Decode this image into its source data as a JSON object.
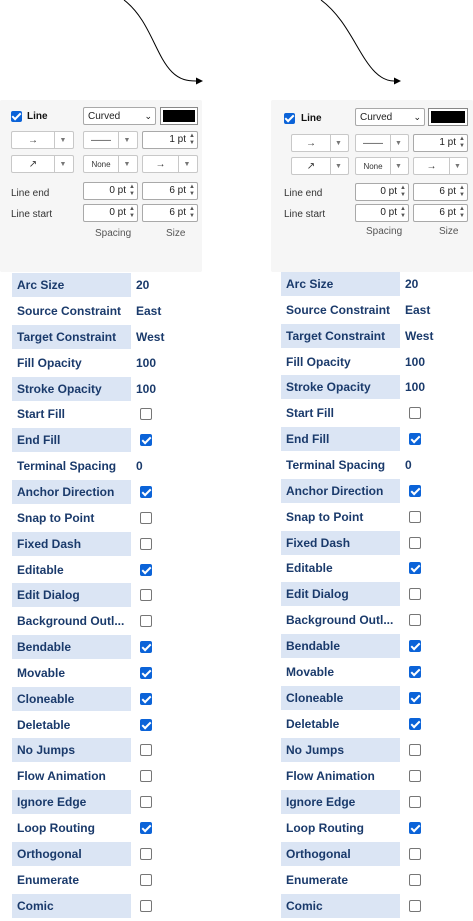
{
  "panel": {
    "line_label": "Line",
    "line_checked": true,
    "style_value": "Curved",
    "stroke_color": "#000000",
    "line_width": "1 pt",
    "waypoint_none": "None",
    "line_end_label": "Line end",
    "line_start_label": "Line start",
    "line_end_spacing": "0 pt",
    "line_end_size": "6 pt",
    "line_start_spacing": "0 pt",
    "line_start_size": "6 pt",
    "spacing_label": "Spacing",
    "size_label": "Size"
  },
  "properties": [
    {
      "name": "Arc Size",
      "value": "20"
    },
    {
      "name": "Source Constraint",
      "value": "East"
    },
    {
      "name": "Target Constraint",
      "value": "West"
    },
    {
      "name": "Fill Opacity",
      "value": "100"
    },
    {
      "name": "Stroke Opacity",
      "value": "100"
    },
    {
      "name": "Start Fill",
      "checked": false
    },
    {
      "name": "End Fill",
      "checked": true
    },
    {
      "name": "Terminal Spacing",
      "value": "0"
    },
    {
      "name": "Anchor Direction",
      "checked": true
    },
    {
      "name": "Snap to Point",
      "checked": false
    },
    {
      "name": "Fixed Dash",
      "checked": false
    },
    {
      "name": "Editable",
      "checked": true
    },
    {
      "name": "Edit Dialog",
      "checked": false
    },
    {
      "name": "Background Outl...",
      "checked": false
    },
    {
      "name": "Bendable",
      "checked": true
    },
    {
      "name": "Movable",
      "checked": true
    },
    {
      "name": "Cloneable",
      "checked": true
    },
    {
      "name": "Deletable",
      "checked": true
    },
    {
      "name": "No Jumps",
      "checked": false
    },
    {
      "name": "Flow Animation",
      "checked": false
    },
    {
      "name": "Ignore Edge",
      "checked": false
    },
    {
      "name": "Loop Routing",
      "checked": true
    },
    {
      "name": "Orthogonal",
      "checked": false
    },
    {
      "name": "Enumerate",
      "checked": false
    },
    {
      "name": "Comic",
      "checked": false
    }
  ]
}
